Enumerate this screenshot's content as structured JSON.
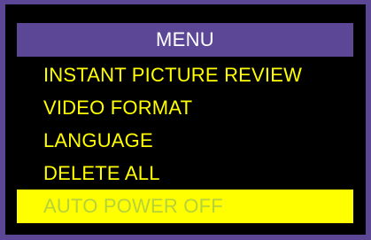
{
  "menu": {
    "title": "MENU",
    "items": [
      {
        "label": "INSTANT PICTURE REVIEW",
        "selected": false
      },
      {
        "label": "VIDEO FORMAT",
        "selected": false
      },
      {
        "label": "LANGUAGE",
        "selected": false
      },
      {
        "label": "DELETE ALL",
        "selected": false
      },
      {
        "label": "AUTO POWER OFF",
        "selected": true
      }
    ]
  },
  "colors": {
    "frame": "#5b4796",
    "background": "#000000",
    "item_text": "#ffff00",
    "selected_background": "#ffff00",
    "selected_text": "#b7d23a"
  }
}
